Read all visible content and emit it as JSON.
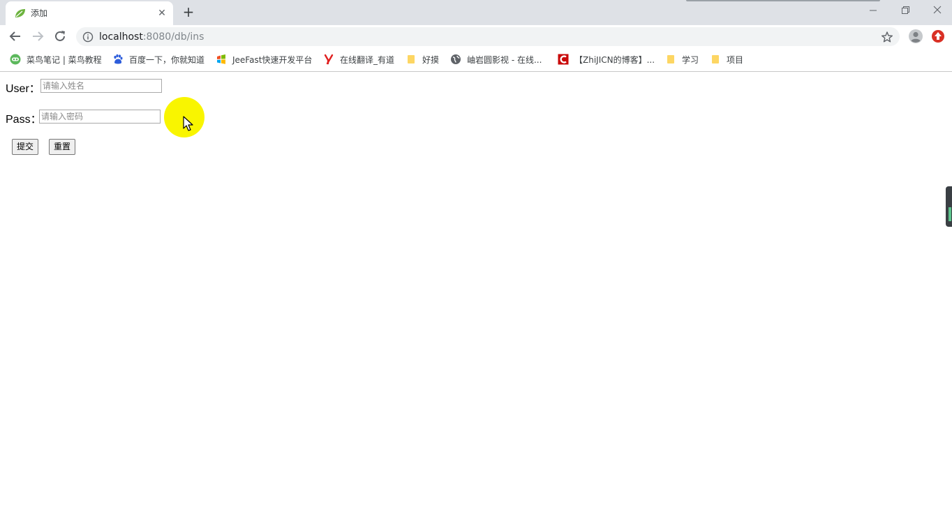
{
  "tab": {
    "title": "添加",
    "close_glyph": "✕",
    "new_tab_glyph": "+"
  },
  "toolbar": {
    "url_host": "localhost",
    "url_rest": ":8080/db/ins"
  },
  "bookmarks": [
    {
      "label": "菜鸟笔记 | 菜鸟教程",
      "icon": "runoob-icon"
    },
    {
      "label": "百度一下，你就知道",
      "icon": "baidu-paw-icon"
    },
    {
      "label": "JeeFast快速开发平台",
      "icon": "jeefast-icon"
    },
    {
      "label": "在线翻译_有道",
      "icon": "youdao-icon"
    },
    {
      "label": "好摸",
      "icon": "folder-icon"
    },
    {
      "label": "岫岩圆影视 - 在线...",
      "icon": "globe-icon"
    },
    {
      "label": "【ZhiJICN的博客】...",
      "icon": "csdn-icon"
    },
    {
      "label": "学习",
      "icon": "folder-icon"
    },
    {
      "label": "项目",
      "icon": "folder-icon"
    }
  ],
  "form": {
    "user_label": "User：",
    "user_placeholder": "请输入姓名",
    "pass_label": "Pass：",
    "pass_placeholder": "请输入密码",
    "submit_label": "提交",
    "reset_label": "重置"
  },
  "colors": {
    "tabstrip_bg": "#dee1e6",
    "omnibox_bg": "#f1f3f4",
    "click_highlight": "#f9f500",
    "extension_red": "#d93025",
    "folder_yellow": "#fdd663"
  }
}
